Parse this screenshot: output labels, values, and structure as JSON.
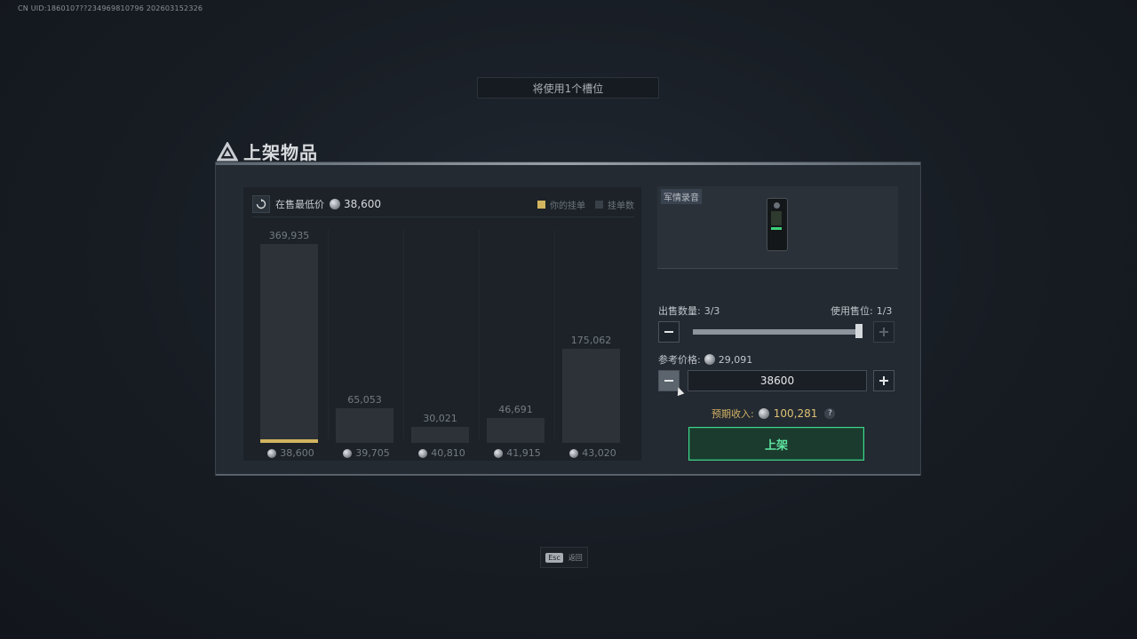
{
  "uid": "CN UID:1860107??234969810796 202603152326",
  "slot_banner": "将使用1个槽位",
  "dialog": {
    "title": "上架物品"
  },
  "chart": {
    "lowest_label": "在售最低价",
    "lowest_value": "38,600",
    "legend_own": "你的挂单",
    "legend_count": "挂单数"
  },
  "chart_data": {
    "type": "bar",
    "categories": [
      "38,600",
      "39,705",
      "40,810",
      "41,915",
      "43,020"
    ],
    "values": [
      369935,
      65053,
      30021,
      46691,
      175062
    ],
    "value_labels": [
      "369,935",
      "65,053",
      "30,021",
      "46,691",
      "175,062"
    ],
    "own_listing_index": 0,
    "ylim": [
      0,
      369935
    ],
    "grid": false,
    "legend": "top-right",
    "colors": {
      "bar": "#2c3238",
      "own": "#d2b45f",
      "count": "#3a4047"
    }
  },
  "item": {
    "tag": "军情录音"
  },
  "sell": {
    "qty_label": "出售数量:",
    "qty_value": "3/3",
    "slot_label": "使用售位:",
    "slot_value": "1/3",
    "quantity_fraction": 1.0
  },
  "price": {
    "ref_label": "参考价格:",
    "ref_value": "29,091",
    "input_value": "38600",
    "expected_label": "预期收入:",
    "expected_value": "100,281",
    "help": "?"
  },
  "list_button": "上架",
  "footer": {
    "esc_key": "Esc",
    "esc_label": "返回"
  },
  "colors": {
    "accent_green": "#3fd58a",
    "gold": "#dfc173"
  }
}
